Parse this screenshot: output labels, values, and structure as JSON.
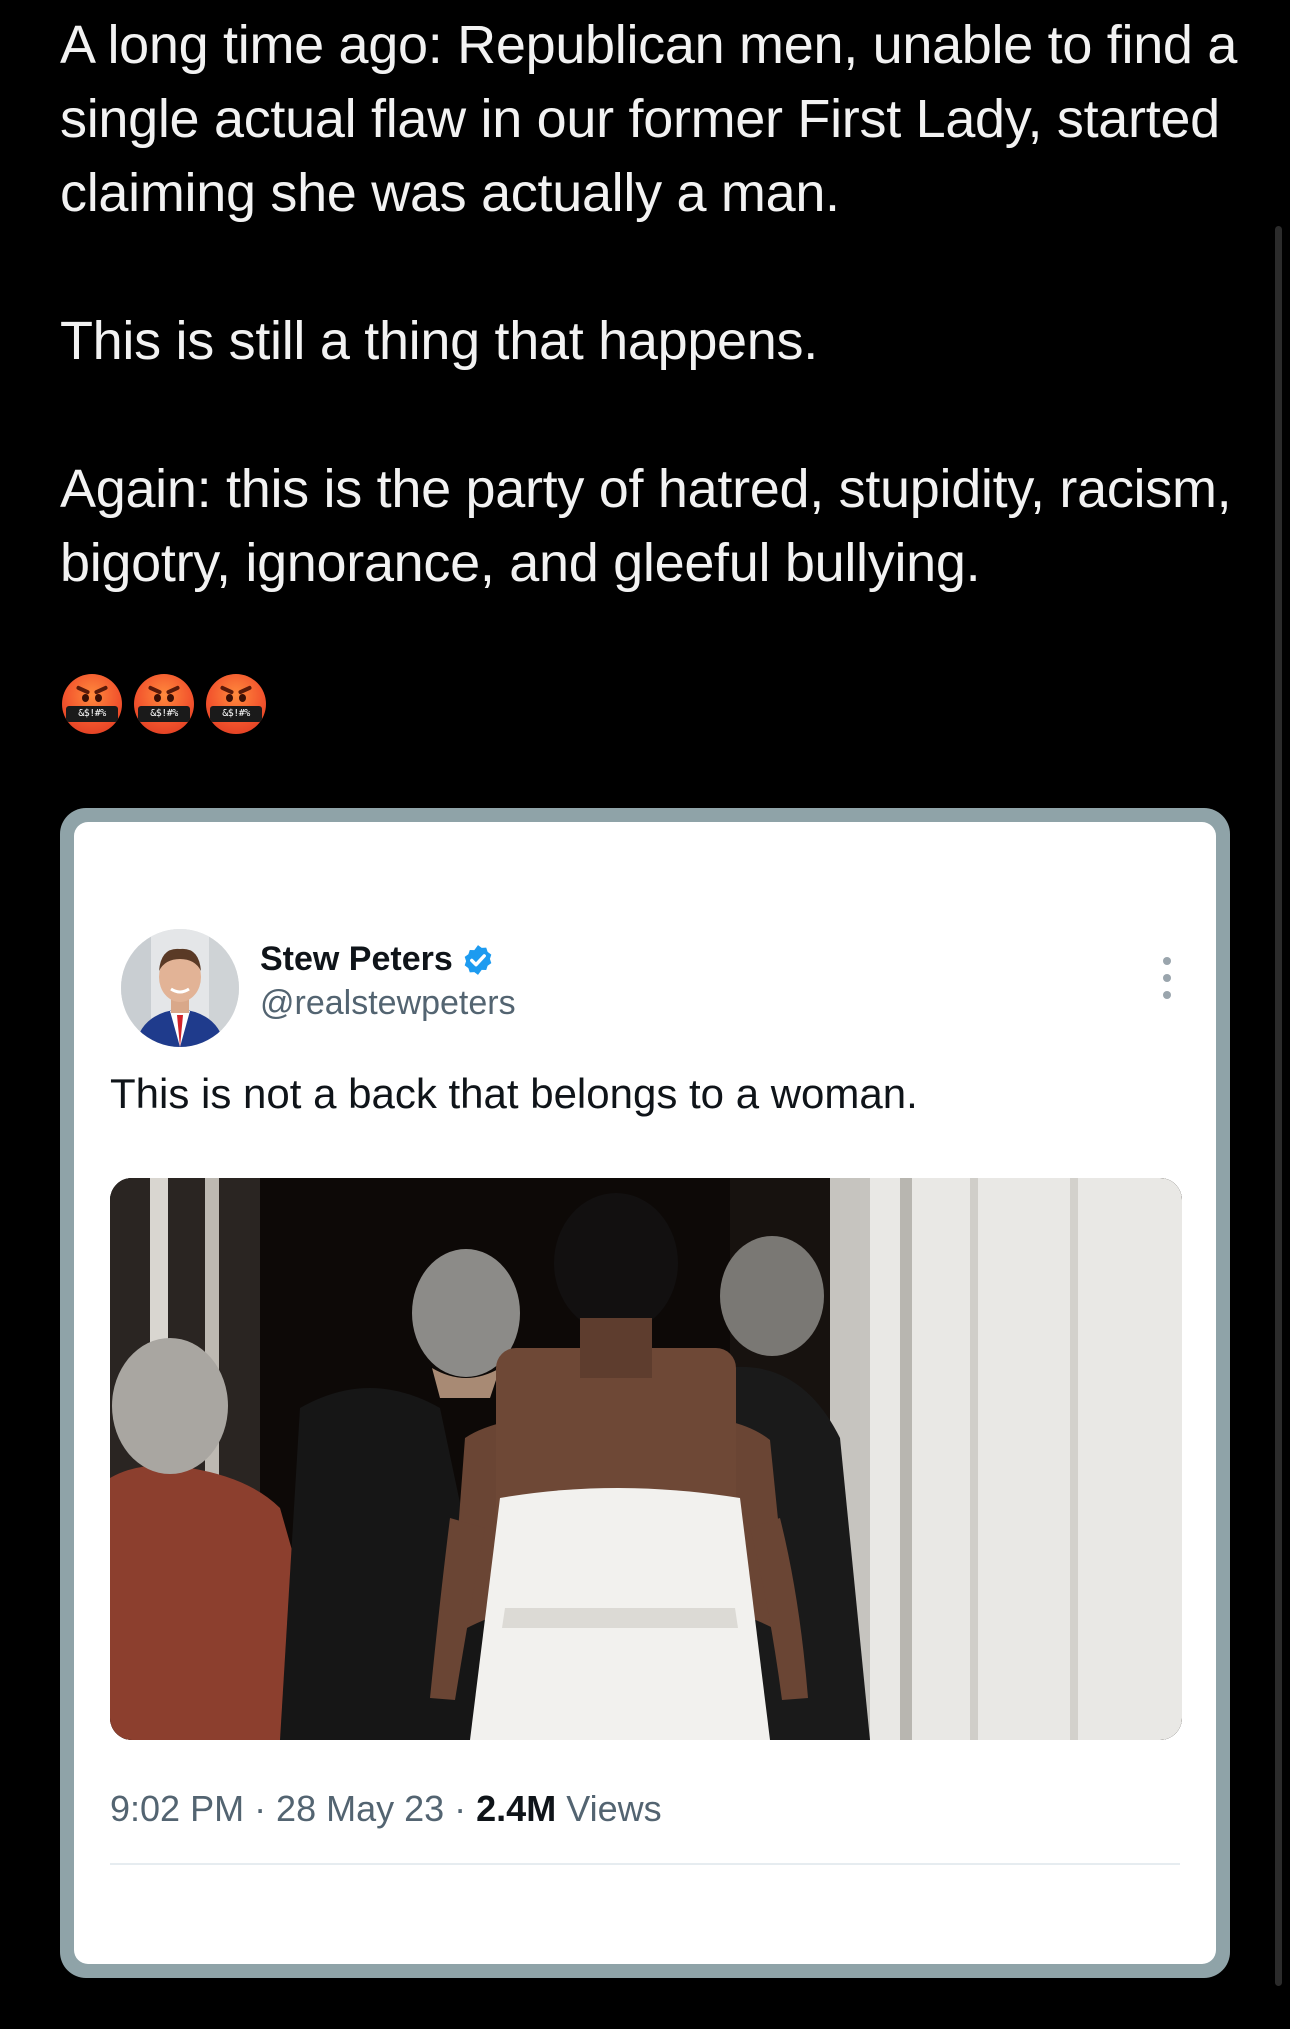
{
  "post": {
    "paragraphs": [
      "A long time ago: Republican men, unable to find a single actual flaw in our former First Lady, started claiming she was actually a man.",
      "This is still a thing that happens.",
      "Again: this is the party of hatred, stupidity, racism, bigotry, ignorance, and gleeful bullying."
    ],
    "emojis": [
      {
        "icon": "face-with-symbols-on-mouth-icon",
        "symbol": "&$!#%"
      },
      {
        "icon": "face-with-symbols-on-mouth-icon",
        "symbol": "&$!#%"
      },
      {
        "icon": "face-with-symbols-on-mouth-icon",
        "symbol": "&$!#%"
      }
    ]
  },
  "quoted_tweet": {
    "author_name": "Stew Peters",
    "author_handle": "@realstewpeters",
    "verified": true,
    "text": "This is not a back that belongs to a woman.",
    "timestamp": "9:02 PM · 28 May 23 · ",
    "views_count": "2.4M",
    "views_label": " Views"
  },
  "colors": {
    "background": "#000000",
    "card_frame": "#8fa3a8",
    "card_background": "#ffffff",
    "verified_badge": "#1d9bf0",
    "secondary_text": "#536471"
  }
}
